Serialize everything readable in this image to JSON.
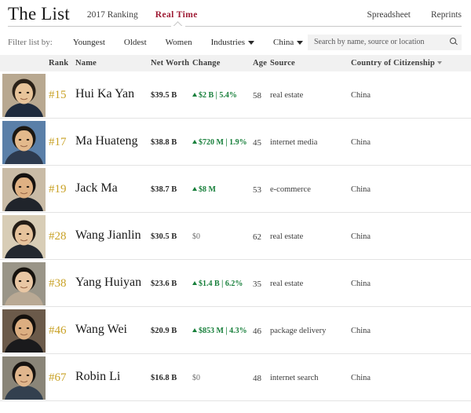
{
  "header": {
    "brand": "The List",
    "nav_left": [
      {
        "label": "2017 Ranking",
        "active": false
      },
      {
        "label": "Real Time",
        "active": true
      }
    ],
    "nav_right": [
      {
        "label": "Spreadsheet"
      },
      {
        "label": "Reprints"
      }
    ]
  },
  "filters": {
    "label": "Filter list by:",
    "items": [
      {
        "label": "Youngest",
        "dropdown": false
      },
      {
        "label": "Oldest",
        "dropdown": false
      },
      {
        "label": "Women",
        "dropdown": false
      },
      {
        "label": "Industries",
        "dropdown": true
      },
      {
        "label": "China",
        "dropdown": true
      }
    ],
    "search_placeholder": "Search by name, source or location",
    "search_value": "",
    "search_icon": "search-icon"
  },
  "table": {
    "columns": [
      {
        "key": "rank",
        "label": "Rank"
      },
      {
        "key": "name",
        "label": "Name"
      },
      {
        "key": "net_worth",
        "label": "Net Worth"
      },
      {
        "key": "change",
        "label": "Change"
      },
      {
        "key": "age",
        "label": "Age"
      },
      {
        "key": "source",
        "label": "Source"
      },
      {
        "key": "country",
        "label": "Country of Citizenship",
        "sorted": true
      }
    ],
    "rows": [
      {
        "rank": "#15",
        "name": "Hui Ka Yan",
        "net_worth": "$39.5 B",
        "change": "$2 B | 5.4%",
        "change_dir": "up",
        "age": "58",
        "source": "real estate",
        "country": "China",
        "avatar_skin": "#e8c49a",
        "avatar_hair": "#2a2118",
        "avatar_cloth": "#1f2b3d",
        "avatar_bg": "#b8a890"
      },
      {
        "rank": "#17",
        "name": "Ma Huateng",
        "net_worth": "$38.8 B",
        "change": "$720 M | 1.9%",
        "change_dir": "up",
        "age": "45",
        "source": "internet media",
        "country": "China",
        "avatar_skin": "#e3b98c",
        "avatar_hair": "#1b1712",
        "avatar_cloth": "#2d3a4e",
        "avatar_bg": "#5a7fa8"
      },
      {
        "rank": "#19",
        "name": "Jack Ma",
        "net_worth": "$38.7 B",
        "change": "$8 M",
        "change_dir": "up",
        "age": "53",
        "source": "e-commerce",
        "country": "China",
        "avatar_skin": "#dfb183",
        "avatar_hair": "#151210",
        "avatar_cloth": "#20242b",
        "avatar_bg": "#c9bba6"
      },
      {
        "rank": "#28",
        "name": "Wang Jianlin",
        "net_worth": "$30.5 B",
        "change": "$0",
        "change_dir": "none",
        "age": "62",
        "source": "real estate",
        "country": "China",
        "avatar_skin": "#e6c39c",
        "avatar_hair": "#241d16",
        "avatar_cloth": "#23282f",
        "avatar_bg": "#d8cdb6"
      },
      {
        "rank": "#38",
        "name": "Yang Huiyan",
        "net_worth": "$23.6 B",
        "change": "$1.4 B | 6.2%",
        "change_dir": "up",
        "age": "35",
        "source": "real estate",
        "country": "China",
        "avatar_skin": "#e9c7a4",
        "avatar_hair": "#16120e",
        "avatar_cloth": "#b9a994",
        "avatar_bg": "#9a9588"
      },
      {
        "rank": "#46",
        "name": "Wang Wei",
        "net_worth": "$20.9 B",
        "change": "$853 M | 4.3%",
        "change_dir": "up",
        "age": "46",
        "source": "package delivery",
        "country": "China",
        "avatar_skin": "#dcae81",
        "avatar_hair": "#14100d",
        "avatar_cloth": "#1a1a1c",
        "avatar_bg": "#6b5a4a"
      },
      {
        "rank": "#67",
        "name": "Robin Li",
        "net_worth": "$16.8 B",
        "change": "$0",
        "change_dir": "none",
        "age": "48",
        "source": "internet search",
        "country": "China",
        "avatar_skin": "#e0b68d",
        "avatar_hair": "#171310",
        "avatar_cloth": "#33404f",
        "avatar_bg": "#8a8578"
      }
    ]
  },
  "colors": {
    "accent_red": "#9e1b34",
    "rank_gold": "#c9a227",
    "change_green": "#19803c",
    "header_bg": "#f1f1f1"
  }
}
